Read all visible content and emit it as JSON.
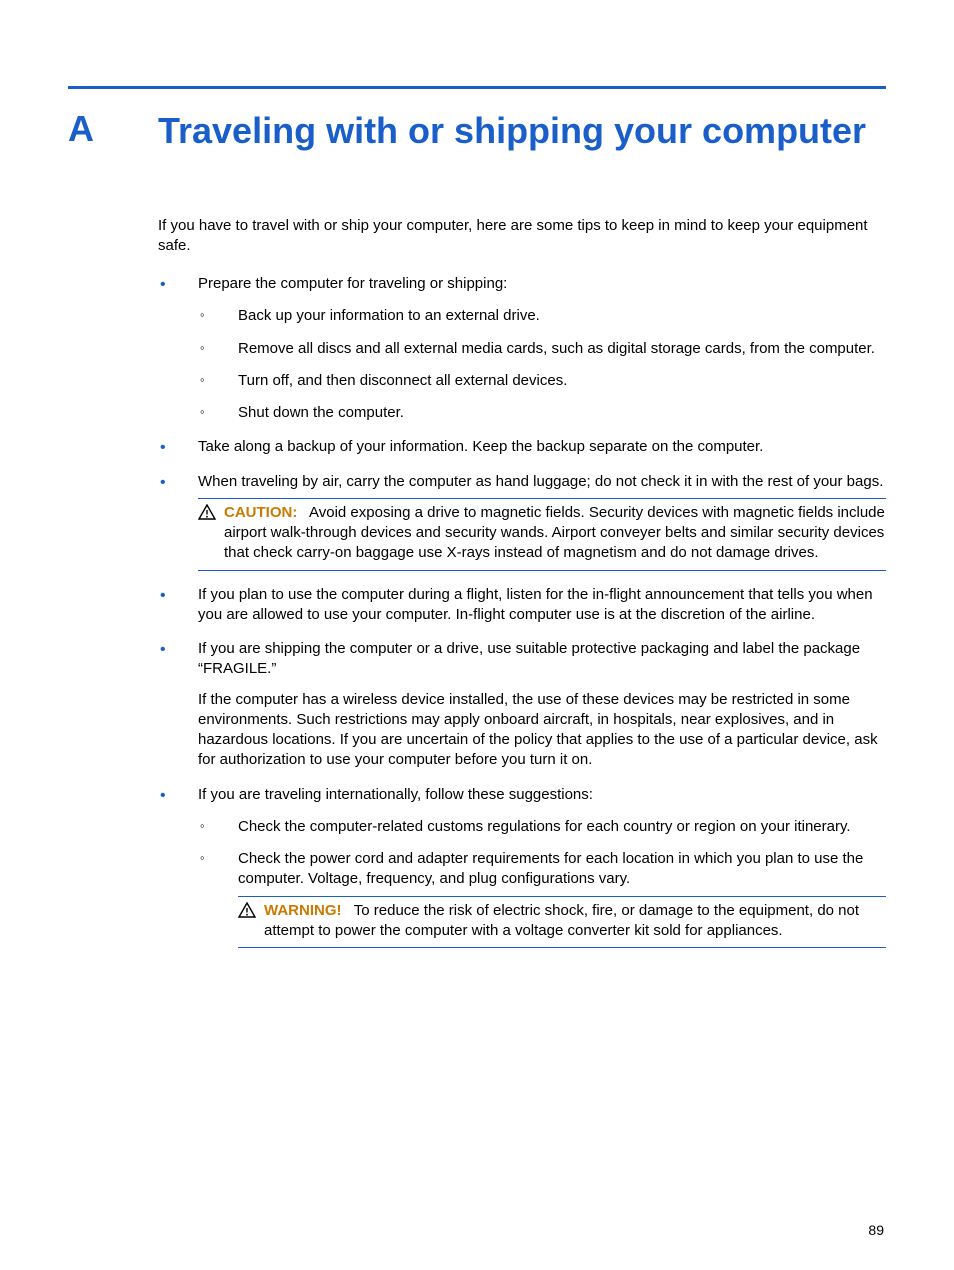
{
  "appendix_letter": "A",
  "title": "Traveling with or shipping your computer",
  "intro": "If you have to travel with or ship your computer, here are some tips to keep in mind to keep your equipment safe.",
  "bullets": {
    "b1": "Prepare the computer for traveling or shipping:",
    "b1_sub": [
      "Back up your information to an external drive.",
      "Remove all discs and all external media cards, such as digital storage cards, from the computer.",
      "Turn off, and then disconnect all external devices.",
      "Shut down the computer."
    ],
    "b2": "Take along a backup of your information. Keep the backup separate on the computer.",
    "b3": "When traveling by air, carry the computer as hand luggage; do not check it in with the rest of your bags.",
    "caution_label": "CAUTION:",
    "caution_text": "Avoid exposing a drive to magnetic fields. Security devices with magnetic fields include airport walk-through devices and security wands. Airport conveyer belts and similar security devices that check carry-on baggage use X-rays instead of magnetism and do not damage drives.",
    "b4": "If you plan to use the computer during a flight, listen for the in-flight announcement that tells you when you are allowed to use your computer. In-flight computer use is at the discretion of the airline.",
    "b5": "If you are shipping the computer or a drive, use suitable protective packaging and label the package “FRAGILE.”",
    "b5_extra": "If the computer has a wireless device installed, the use of these devices may be restricted in some environments. Such restrictions may apply onboard aircraft, in hospitals, near explosives, and in hazardous locations. If you are uncertain of the policy that applies to the use of a particular device, ask for authorization to use your computer before you turn it on.",
    "b6": "If you are traveling internationally, follow these suggestions:",
    "b6_sub": [
      "Check the computer-related customs regulations for each country or region on your itinerary.",
      "Check the power cord and adapter requirements for each location in which you plan to use the computer. Voltage, frequency, and plug configurations vary."
    ],
    "warning_label": "WARNING!",
    "warning_text": "To reduce the risk of electric shock, fire, or damage to the equipment, do not attempt to power the computer with a voltage converter kit sold for appliances."
  },
  "page_number": "89"
}
